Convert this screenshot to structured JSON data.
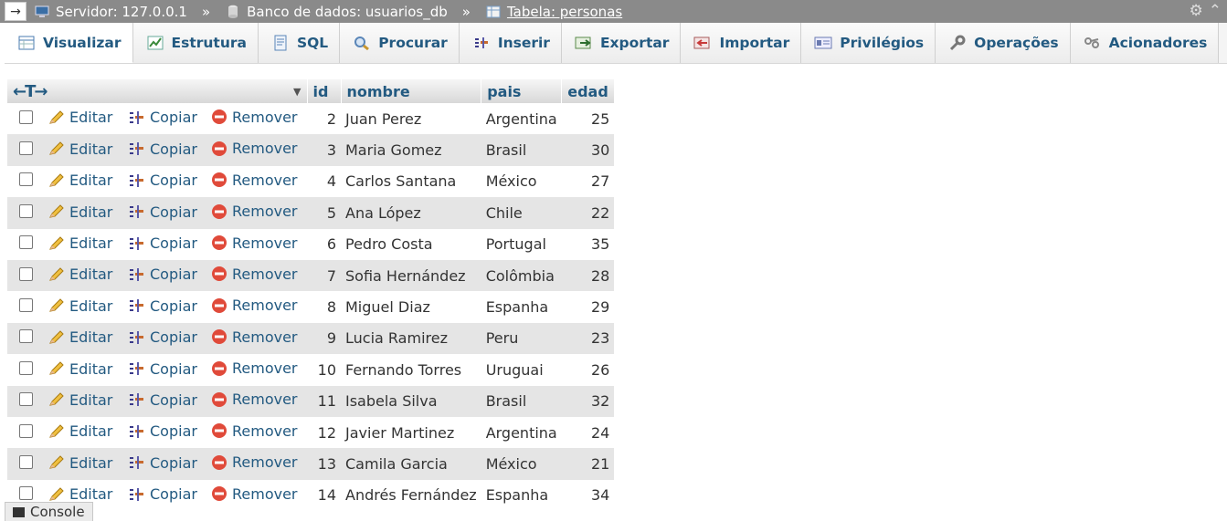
{
  "breadcrumb": {
    "server": "Servidor: 127.0.0.1",
    "database": "Banco de dados: usuarios_db",
    "table": "Tabela: personas",
    "separator": "»"
  },
  "tabs": [
    {
      "label": "Visualizar",
      "icon": "browse-icon",
      "active": true
    },
    {
      "label": "Estrutura",
      "icon": "structure-icon"
    },
    {
      "label": "SQL",
      "icon": "sql-icon"
    },
    {
      "label": "Procurar",
      "icon": "search-icon"
    },
    {
      "label": "Inserir",
      "icon": "insert-icon"
    },
    {
      "label": "Exportar",
      "icon": "export-icon"
    },
    {
      "label": "Importar",
      "icon": "import-icon"
    },
    {
      "label": "Privilégios",
      "icon": "privileges-icon"
    },
    {
      "label": "Operações",
      "icon": "operations-icon"
    },
    {
      "label": "Acionadores",
      "icon": "triggers-icon"
    }
  ],
  "table": {
    "columns": [
      "id",
      "nombre",
      "pais",
      "edad"
    ],
    "actions": {
      "edit": "Editar",
      "copy": "Copiar",
      "delete": "Remover"
    },
    "rows": [
      {
        "id": "2",
        "nombre": "Juan Perez",
        "pais": "Argentina",
        "edad": "25"
      },
      {
        "id": "3",
        "nombre": "Maria Gomez",
        "pais": "Brasil",
        "edad": "30"
      },
      {
        "id": "4",
        "nombre": "Carlos Santana",
        "pais": "México",
        "edad": "27"
      },
      {
        "id": "5",
        "nombre": "Ana López",
        "pais": "Chile",
        "edad": "22"
      },
      {
        "id": "6",
        "nombre": "Pedro Costa",
        "pais": "Portugal",
        "edad": "35"
      },
      {
        "id": "7",
        "nombre": "Sofia Hernández",
        "pais": "Colômbia",
        "edad": "28"
      },
      {
        "id": "8",
        "nombre": "Miguel Diaz",
        "pais": "Espanha",
        "edad": "29"
      },
      {
        "id": "9",
        "nombre": "Lucia Ramirez",
        "pais": "Peru",
        "edad": "23"
      },
      {
        "id": "10",
        "nombre": "Fernando Torres",
        "pais": "Uruguai",
        "edad": "26"
      },
      {
        "id": "11",
        "nombre": "Isabela Silva",
        "pais": "Brasil",
        "edad": "32"
      },
      {
        "id": "12",
        "nombre": "Javier Martinez",
        "pais": "Argentina",
        "edad": "24"
      },
      {
        "id": "13",
        "nombre": "Camila Garcia",
        "pais": "México",
        "edad": "21"
      },
      {
        "id": "14",
        "nombre": "Andrés Fernández",
        "pais": "Espanha",
        "edad": "34"
      }
    ]
  },
  "console": {
    "label": "Console"
  },
  "colors": {
    "link": "#235a81",
    "topbar": "#8a8a8a",
    "row_alt": "#e5e5e5"
  }
}
